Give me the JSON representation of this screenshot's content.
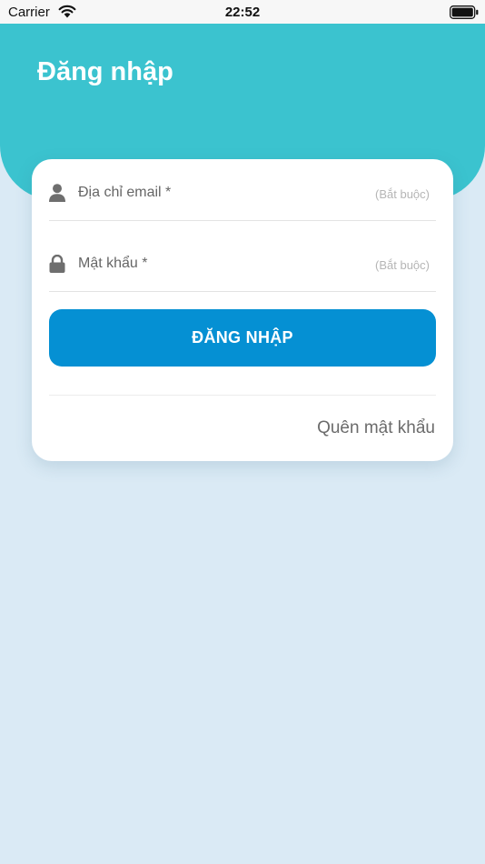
{
  "status_bar": {
    "carrier": "Carrier",
    "time": "22:52",
    "icons": [
      "wifi-icon",
      "battery-icon"
    ]
  },
  "header": {
    "title": "Đăng nhập",
    "color": "#3bc3cf"
  },
  "form": {
    "email": {
      "placeholder": "Địa chỉ email *",
      "hint": "(Bắt buộc)",
      "icon": "user-icon"
    },
    "password": {
      "placeholder": "Mật khẩu *",
      "hint": "(Bắt buộc)",
      "icon": "lock-icon"
    },
    "submit_label": "ĐĂNG NHẬP",
    "forgot_label": "Quên mật khẩu"
  },
  "colors": {
    "accent": "#0590d3",
    "background": "#daeaf5",
    "header": "#3bc3cf"
  }
}
